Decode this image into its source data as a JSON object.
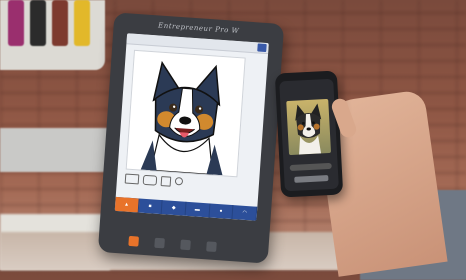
{
  "scene": {
    "description_tags": [
      "embroidery-machine-tablet",
      "smartphone",
      "dog-illustration"
    ]
  },
  "tablet": {
    "brand_text": "Entrepreneur Pro W",
    "menu": [
      "",
      "",
      "",
      "",
      "",
      ""
    ]
  },
  "phone": {
    "photo_subject": "dog"
  },
  "colors": {
    "accent_blue": "#2c4f9a",
    "accent_orange": "#e8732a",
    "dog_fur_dark": "#2b3a55",
    "dog_fur_tan": "#d1892e"
  }
}
